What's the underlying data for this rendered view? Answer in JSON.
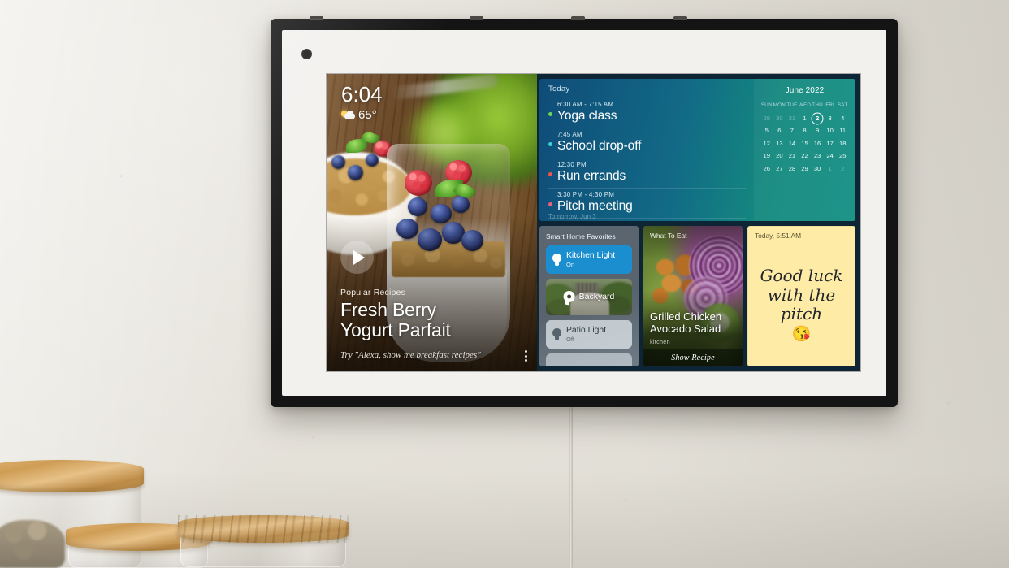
{
  "device": {
    "name": "smart-display",
    "frame_color": "#141414",
    "bezel_color": "#f3f1ee"
  },
  "screen": {
    "hero": {
      "clock": "6:04",
      "temperature": "65°",
      "weather_icon": "partly-cloudy-icon",
      "kicker": "Popular Recipes",
      "title_line1": "Fresh Berry",
      "title_line2": "Yogurt Parfait",
      "prompt": "Try \"Alexa, show me breakfast recipes\"",
      "play_label": "Play",
      "menu_label": "More options"
    },
    "agenda": {
      "header": "Today",
      "next_day": "Tomorrow, Jun 3",
      "events": [
        {
          "time": "6:30 AM - 7:15 AM",
          "title": "Yoga class",
          "color": "#6fd44f"
        },
        {
          "time": "7:45 AM",
          "title": "School drop-off",
          "color": "#3ecfd8"
        },
        {
          "time": "12:30 PM",
          "title": "Run errands",
          "color": "#ef5350"
        },
        {
          "time": "3:30 PM - 4:30 PM",
          "title": "Pitch meeting",
          "color": "#ef5e7a"
        }
      ]
    },
    "calendar": {
      "title": "June 2022",
      "weekdays": [
        "SUN",
        "MON",
        "TUE",
        "WED",
        "THU",
        "FRI",
        "SAT"
      ],
      "weeks": [
        [
          {
            "d": "29",
            "muted": true
          },
          {
            "d": "30",
            "muted": true
          },
          {
            "d": "31",
            "muted": true
          },
          {
            "d": "1"
          },
          {
            "d": "2",
            "today": true
          },
          {
            "d": "3"
          },
          {
            "d": "4"
          }
        ],
        [
          {
            "d": "5"
          },
          {
            "d": "6"
          },
          {
            "d": "7"
          },
          {
            "d": "8"
          },
          {
            "d": "9"
          },
          {
            "d": "10"
          },
          {
            "d": "11"
          }
        ],
        [
          {
            "d": "12"
          },
          {
            "d": "13"
          },
          {
            "d": "14"
          },
          {
            "d": "15"
          },
          {
            "d": "16"
          },
          {
            "d": "17"
          },
          {
            "d": "18"
          }
        ],
        [
          {
            "d": "19"
          },
          {
            "d": "20"
          },
          {
            "d": "21"
          },
          {
            "d": "22"
          },
          {
            "d": "23"
          },
          {
            "d": "24"
          },
          {
            "d": "25"
          }
        ],
        [
          {
            "d": "26"
          },
          {
            "d": "27"
          },
          {
            "d": "28"
          },
          {
            "d": "29"
          },
          {
            "d": "30"
          },
          {
            "d": "1",
            "muted": true
          },
          {
            "d": "2",
            "muted": true
          }
        ]
      ]
    },
    "smart_home": {
      "header": "Smart Home Favorites",
      "devices": [
        {
          "name": "Kitchen Light",
          "state": "On",
          "type": "light",
          "active": true
        },
        {
          "name": "Backyard",
          "state": "",
          "type": "camera",
          "active": false
        },
        {
          "name": "Patio Light",
          "state": "Off",
          "type": "light",
          "active": false
        }
      ]
    },
    "recipe_card": {
      "kicker": "What To Eat",
      "title_line1": "Grilled Chicken",
      "title_line2": "Avocado Salad",
      "source": "kitchen",
      "action": "Show Recipe"
    },
    "note": {
      "timestamp": "Today, 5:51 AM",
      "line1": "Good luck",
      "line2": "with the",
      "line3": "pitch",
      "emoji": "😘"
    }
  },
  "colors": {
    "accent_blue": "#1a8ecf",
    "panel_teal": "#14897f",
    "panel_blue": "#0f4c78",
    "note_yellow": "#fdeba6",
    "smart_panel": "#5c6670"
  }
}
